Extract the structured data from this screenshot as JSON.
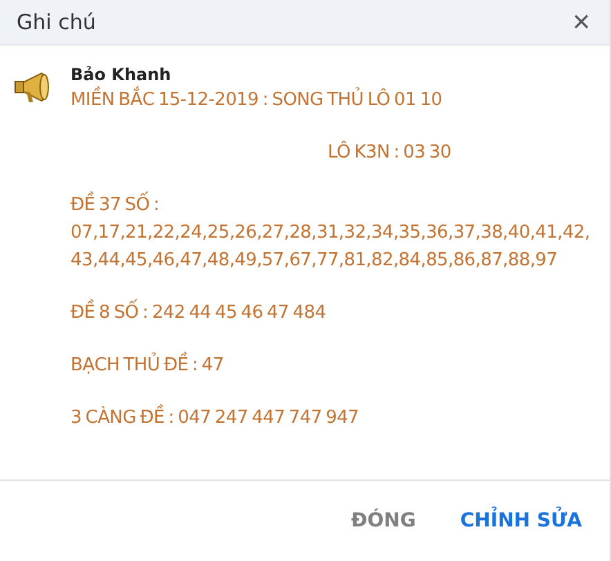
{
  "window": {
    "title": "Ghi chú",
    "close": "×"
  },
  "note": {
    "author": "Bảo Khanh",
    "paragraphs": [
      {
        "text": "MIỀN BẮC 15-12-2019 : SONG THỦ LÔ 01 10",
        "indent": false
      },
      {
        "text": "LÔ K3N : 03 30",
        "indent": true
      },
      {
        "text": "ĐỀ 37 SỐ : 07,17,21,22,24,25,26,27,28,31,32,34,35,36,37,38,40,41,42, 43,44,45,46,47,48,49,57,67,77,81,82,84,85,86,87,88,97",
        "indent": false
      },
      {
        "text": "ĐỀ 8 SỐ  : 242 44 45 46 47 484",
        "indent": false
      },
      {
        "text": "BẠCH THỦ ĐỀ : 47",
        "indent": false
      },
      {
        "text": "3 CÀNG ĐỀ : 047 247 447 747 947",
        "indent": false
      }
    ]
  },
  "buttons": [
    {
      "label": "ĐÓNG",
      "kind": "secondary"
    },
    {
      "label": "CHỈNH SỬA",
      "kind": "primary"
    }
  ]
}
